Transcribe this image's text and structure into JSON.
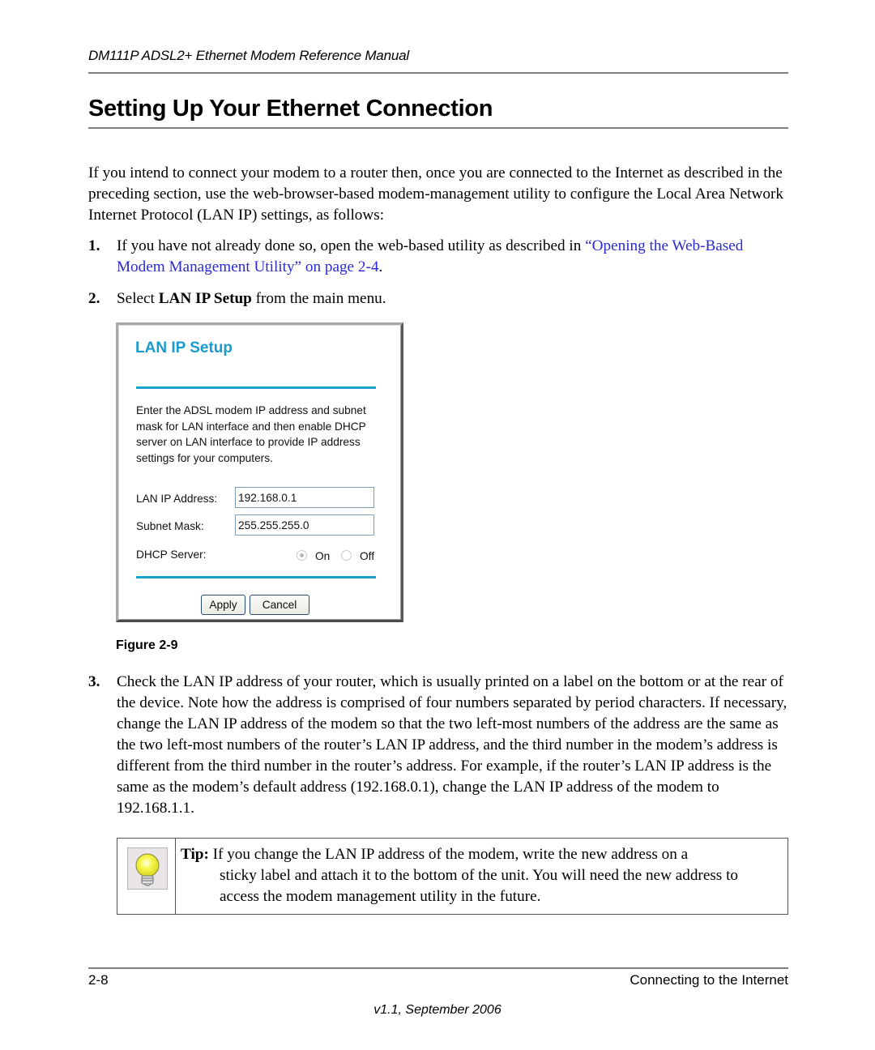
{
  "header": {
    "running_title": "DM111P ADSL2+ Ethernet Modem Reference Manual"
  },
  "section": {
    "title": "Setting Up Your Ethernet Connection",
    "intro": "If you intend to connect your modem to a router then, once you are connected to the Internet as described in the preceding section, use the web-browser-based modem-management utility to configure the Local Area Network Internet Protocol (LAN IP) settings, as follows:"
  },
  "steps": [
    {
      "number": "1.",
      "text_before": "If you have not already done so, open the web-based utility as described in ",
      "link_text": "“Opening the Web-Based Modem Management Utility” on page 2-4",
      "text_after": "."
    },
    {
      "number": "2.",
      "text_before": "Select ",
      "bold_text": "LAN IP Setup",
      "text_after": " from the main menu."
    },
    {
      "number": "3.",
      "text": "Check the LAN IP address of your router, which is usually printed on a label on the bottom or at the rear of the device. Note how the address is comprised of four numbers separated by period characters. If necessary, change the LAN IP address of the modem so that the two left-most numbers of the address are the same as the two left-most numbers of the router’s LAN IP address, and the third number in the modem’s address is different from the third number in the router’s address. For example, if the router’s LAN IP address is the same as the modem’s default address (192.168.0.1), change the LAN IP address of the modem to 192.168.1.1."
    }
  ],
  "figure": {
    "screen_title": "LAN IP Setup",
    "description": "Enter the ADSL modem IP address and subnet mask for LAN interface and then enable DHCP server on LAN interface to provide IP address settings for your computers.",
    "lan_ip_label": "LAN IP Address:",
    "lan_ip_value": "192.168.0.1",
    "subnet_label": "Subnet Mask:",
    "subnet_value": "255.255.255.0",
    "dhcp_label": "DHCP Server:",
    "dhcp_on_label": "On",
    "dhcp_off_label": "Off",
    "dhcp_selected": "On",
    "apply_label": "Apply",
    "cancel_label": "Cancel",
    "accent_color": "#1aa0cc",
    "caption": "Figure 2-9"
  },
  "tip": {
    "icon": "lightbulb-icon",
    "label": "Tip:",
    "line1": " If you change the LAN IP address of the modem, write the new address on a",
    "rest": "sticky label and attach it to the bottom of the unit. You will need the new address to access the modem management utility in the future."
  },
  "footer": {
    "page_number": "2-8",
    "chapter": "Connecting to the Internet",
    "version": "v1.1, September 2006"
  }
}
